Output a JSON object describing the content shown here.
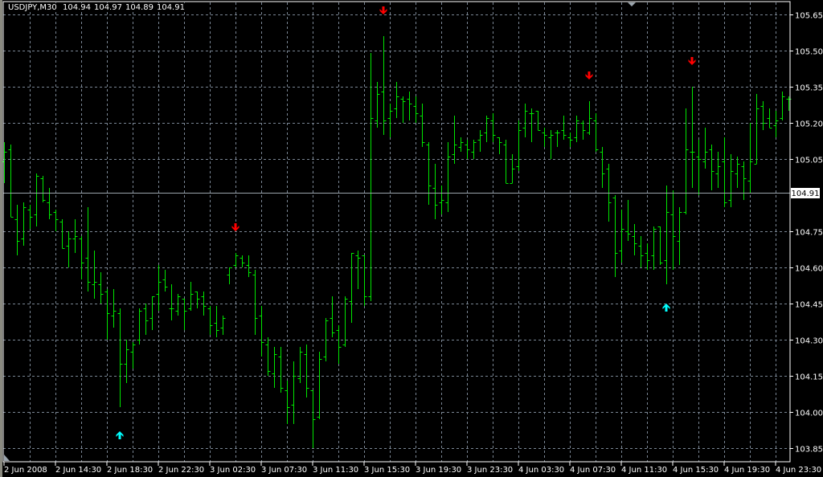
{
  "header": {
    "symbol": "USDJPY,M30",
    "open": "104.94",
    "high": "104.97",
    "low": "104.89",
    "close": "104.91"
  },
  "colors": {
    "background": "#000000",
    "grid": "#7a8694",
    "bars": "#00e600",
    "sell_arrow": "#ff0000",
    "buy_arrow": "#00ffff",
    "axis": "#ffffff"
  },
  "chart_data": {
    "type": "ohlc",
    "title": "USDJPY,M30",
    "ylim": [
      103.85,
      105.65
    ],
    "grid": true,
    "y_ticks": [
      "105.65",
      "105.50",
      "105.35",
      "105.20",
      "105.05",
      "104.75",
      "104.60",
      "104.45",
      "104.30",
      "104.15",
      "104.00",
      "103.85"
    ],
    "y_tick_values": [
      105.65,
      105.5,
      105.35,
      105.2,
      105.05,
      104.75,
      104.6,
      104.45,
      104.3,
      104.15,
      104.0,
      103.85
    ],
    "current_price": "104.91",
    "x_ticks": [
      "2 Jun 2008",
      "2 Jun 14:30",
      "2 Jun 18:30",
      "2 Jun 22:30",
      "3 Jun 02:30",
      "3 Jun 07:30",
      "3 Jun 11:30",
      "3 Jun 15:30",
      "3 Jun 19:30",
      "3 Jun 23:30",
      "4 Jun 03:30",
      "4 Jun 07:30",
      "4 Jun 11:30",
      "4 Jun 15:30",
      "4 Jun 19:30",
      "4 Jun 23:30"
    ],
    "x_tick_bar_index": [
      0,
      8,
      16,
      24,
      32,
      40,
      48,
      56,
      64,
      72,
      80,
      88,
      96,
      104,
      112,
      120
    ],
    "bars_ohlc": [
      [
        105.04,
        105.12,
        104.95,
        105.08
      ],
      [
        105.09,
        105.11,
        104.81,
        104.81
      ],
      [
        104.8,
        104.86,
        104.65,
        104.71
      ],
      [
        104.72,
        104.87,
        104.69,
        104.85
      ],
      [
        104.84,
        104.86,
        104.76,
        104.81
      ],
      [
        104.82,
        104.99,
        104.77,
        104.98
      ],
      [
        104.97,
        104.98,
        104.87,
        104.88
      ],
      [
        104.87,
        104.93,
        104.8,
        104.82
      ],
      [
        104.83,
        104.84,
        104.75,
        104.8
      ],
      [
        104.79,
        104.8,
        104.68,
        104.68
      ],
      [
        104.69,
        104.75,
        104.6,
        104.72
      ],
      [
        104.72,
        104.8,
        104.66,
        104.73
      ],
      [
        104.72,
        104.73,
        104.55,
        104.62
      ],
      [
        104.64,
        104.85,
        104.5,
        104.54
      ],
      [
        104.53,
        104.67,
        104.47,
        104.54
      ],
      [
        104.53,
        104.58,
        104.45,
        104.49
      ],
      [
        104.5,
        104.51,
        104.3,
        104.41
      ],
      [
        104.4,
        104.51,
        104.35,
        104.42
      ],
      [
        104.41,
        104.43,
        104.02,
        104.2
      ],
      [
        104.2,
        104.3,
        104.12,
        104.26
      ],
      [
        104.25,
        104.29,
        104.18,
        104.28
      ],
      [
        104.3,
        104.43,
        104.28,
        104.42
      ],
      [
        104.43,
        104.45,
        104.32,
        104.38
      ],
      [
        104.39,
        104.48,
        104.34,
        104.48
      ],
      [
        104.49,
        104.61,
        104.42,
        104.54
      ],
      [
        104.55,
        104.59,
        104.5,
        104.52
      ],
      [
        104.43,
        104.53,
        104.38,
        104.43
      ],
      [
        104.42,
        104.49,
        104.4,
        104.48
      ],
      [
        104.47,
        104.47,
        104.34,
        104.42
      ],
      [
        104.43,
        104.54,
        104.42,
        104.49
      ],
      [
        104.5,
        104.5,
        104.43,
        104.47
      ],
      [
        104.48,
        104.5,
        104.4,
        104.44
      ],
      [
        104.43,
        104.44,
        104.32,
        104.36
      ],
      [
        104.37,
        104.44,
        104.31,
        104.34
      ],
      [
        104.35,
        104.4,
        104.32,
        104.39
      ],
      [
        104.57,
        104.6,
        104.53,
        104.6
      ],
      [
        104.61,
        104.66,
        104.6,
        104.65
      ],
      [
        104.64,
        104.65,
        104.6,
        104.62
      ],
      [
        104.61,
        104.65,
        104.56,
        104.58
      ],
      [
        104.57,
        104.59,
        104.32,
        104.39
      ],
      [
        104.4,
        104.44,
        104.23,
        104.29
      ],
      [
        104.28,
        104.31,
        104.15,
        104.17
      ],
      [
        104.16,
        104.27,
        104.1,
        104.24
      ],
      [
        104.23,
        104.27,
        104.08,
        104.1
      ],
      [
        104.09,
        104.13,
        103.95,
        104.02
      ],
      [
        104.03,
        104.21,
        103.95,
        104.15
      ],
      [
        104.14,
        104.27,
        104.12,
        104.25
      ],
      [
        104.24,
        104.28,
        104.06,
        104.1
      ],
      [
        104.09,
        104.09,
        103.85,
        103.97
      ],
      [
        103.98,
        104.25,
        103.97,
        104.22
      ],
      [
        104.23,
        104.39,
        104.21,
        104.38
      ],
      [
        104.39,
        104.48,
        104.31,
        104.33
      ],
      [
        104.34,
        104.36,
        104.2,
        104.27
      ],
      [
        104.28,
        104.48,
        104.27,
        104.47
      ],
      [
        104.46,
        104.66,
        104.37,
        104.66
      ],
      [
        104.65,
        104.67,
        104.51,
        104.64
      ],
      [
        104.65,
        104.65,
        104.44,
        104.48
      ],
      [
        104.48,
        105.49,
        104.46,
        105.22
      ],
      [
        105.21,
        105.37,
        105.18,
        105.32
      ],
      [
        105.33,
        105.56,
        105.15,
        105.21
      ],
      [
        105.22,
        105.28,
        105.14,
        105.25
      ],
      [
        105.26,
        105.37,
        105.22,
        105.31
      ],
      [
        105.3,
        105.31,
        105.2,
        105.29
      ],
      [
        105.3,
        105.33,
        105.21,
        105.28
      ],
      [
        105.27,
        105.31,
        105.2,
        105.24
      ],
      [
        105.23,
        105.28,
        105.1,
        105.12
      ],
      [
        105.11,
        105.12,
        104.86,
        104.94
      ],
      [
        104.93,
        105.03,
        104.8,
        104.86
      ],
      [
        104.87,
        104.94,
        104.82,
        104.88
      ],
      [
        104.87,
        105.12,
        104.83,
        105.06
      ],
      [
        105.07,
        105.23,
        105.03,
        105.11
      ],
      [
        105.1,
        105.14,
        105.08,
        105.12
      ],
      [
        105.11,
        105.13,
        105.05,
        105.09
      ],
      [
        105.08,
        105.13,
        105.05,
        105.12
      ],
      [
        105.13,
        105.17,
        105.08,
        105.15
      ],
      [
        105.16,
        105.23,
        105.12,
        105.22
      ],
      [
        105.21,
        105.24,
        105.12,
        105.15
      ],
      [
        105.14,
        105.14,
        105.07,
        105.12
      ],
      [
        105.11,
        105.13,
        104.95,
        104.95
      ],
      [
        104.95,
        105.07,
        104.95,
        105.01
      ],
      [
        105.02,
        105.21,
        105.0,
        105.17
      ],
      [
        105.18,
        105.28,
        105.14,
        105.25
      ],
      [
        105.24,
        105.26,
        105.12,
        105.24
      ],
      [
        105.25,
        105.25,
        105.17,
        105.17
      ],
      [
        105.16,
        105.18,
        105.1,
        105.15
      ],
      [
        105.14,
        105.17,
        105.05,
        105.15
      ],
      [
        105.16,
        105.17,
        105.1,
        105.16
      ],
      [
        105.17,
        105.23,
        105.13,
        105.15
      ],
      [
        105.14,
        105.16,
        105.1,
        105.13
      ],
      [
        105.14,
        105.23,
        105.12,
        105.21
      ],
      [
        105.2,
        105.21,
        105.13,
        105.17
      ],
      [
        105.16,
        105.29,
        105.15,
        105.22
      ],
      [
        105.21,
        105.24,
        105.08,
        105.09
      ],
      [
        105.08,
        105.1,
        104.93,
        104.99
      ],
      [
        105.01,
        105.03,
        104.79,
        104.87
      ],
      [
        104.89,
        104.9,
        104.56,
        104.66
      ],
      [
        104.67,
        104.84,
        104.62,
        104.76
      ],
      [
        104.75,
        104.88,
        104.71,
        104.74
      ],
      [
        104.73,
        104.78,
        104.65,
        104.7
      ],
      [
        104.69,
        104.73,
        104.6,
        104.65
      ],
      [
        104.66,
        104.7,
        104.59,
        104.63
      ],
      [
        104.65,
        104.77,
        104.59,
        104.76
      ],
      [
        104.77,
        104.77,
        104.61,
        104.62
      ],
      [
        104.63,
        104.94,
        104.53,
        104.83
      ],
      [
        104.82,
        104.92,
        104.59,
        104.73
      ],
      [
        104.71,
        104.85,
        104.61,
        104.83
      ],
      [
        104.83,
        105.26,
        104.82,
        105.09
      ],
      [
        105.08,
        105.35,
        104.93,
        105.08
      ],
      [
        105.06,
        105.13,
        104.9,
        105.05
      ],
      [
        105.04,
        105.18,
        105.01,
        105.08
      ],
      [
        105.09,
        105.11,
        104.92,
        105.0
      ],
      [
        104.99,
        105.08,
        104.93,
        105.02
      ],
      [
        105.04,
        105.14,
        104.85,
        104.87
      ],
      [
        104.88,
        105.07,
        104.85,
        105.0
      ],
      [
        104.99,
        105.06,
        104.93,
        105.03
      ],
      [
        105.02,
        105.04,
        104.88,
        104.97
      ],
      [
        104.96,
        105.2,
        104.91,
        105.04
      ],
      [
        105.03,
        105.32,
        105.03,
        105.26
      ],
      [
        105.27,
        105.29,
        105.17,
        105.2
      ],
      [
        105.22,
        105.26,
        105.18,
        105.18
      ],
      [
        105.19,
        105.25,
        105.14,
        105.21
      ],
      [
        105.22,
        105.33,
        105.21,
        105.31
      ],
      [
        105.3,
        105.31,
        105.25,
        105.3
      ]
    ],
    "signals": [
      {
        "type": "sell",
        "bar": 36,
        "price": 104.76
      },
      {
        "type": "sell",
        "bar": 59,
        "price": 105.66
      },
      {
        "type": "sell",
        "bar": 91,
        "price": 105.39
      },
      {
        "type": "sell",
        "bar": 107,
        "price": 105.45
      },
      {
        "type": "buy",
        "bar": 18,
        "price": 103.91
      },
      {
        "type": "buy",
        "bar": 103,
        "price": 104.44
      }
    ]
  }
}
